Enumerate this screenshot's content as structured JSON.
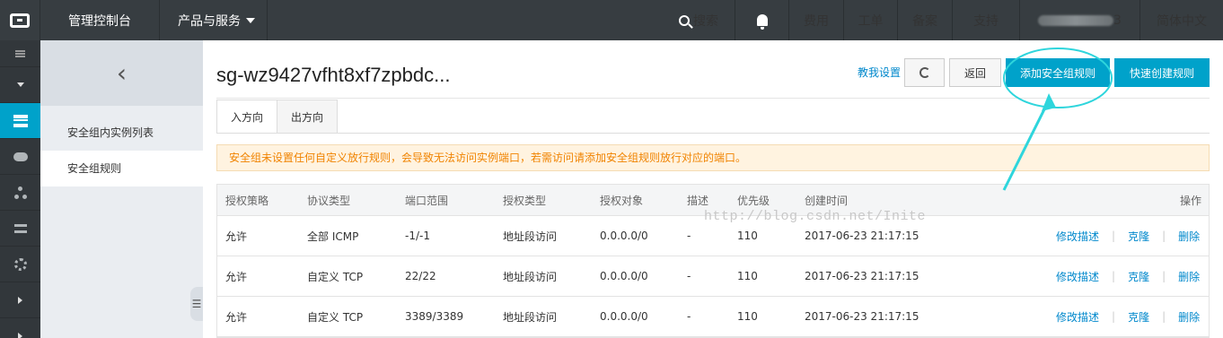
{
  "topbar": {
    "console": "管理控制台",
    "products": "产品与服务",
    "search": "搜索",
    "billing": "费用",
    "tickets": "工单",
    "filing": "备案",
    "support": "支持",
    "user_suffix": "3",
    "language": "简体中文"
  },
  "subnav": {
    "items": [
      {
        "label": "安全组内实例列表"
      },
      {
        "label": "安全组规则"
      }
    ]
  },
  "main": {
    "title": "sg-wz9427vfht8xf7zpbdc...",
    "help": "教我设置",
    "back": "返回",
    "add_rule": "添加安全组规则",
    "quick_create": "快速创建规则",
    "tabs": [
      {
        "label": "入方向"
      },
      {
        "label": "出方向"
      }
    ],
    "notice": "安全组未设置任何自定义放行规则，会导致无法访问实例端口，若需访问请添加安全组规则放行对应的端口。",
    "watermark": "http://blog.csdn.net/Inite"
  },
  "table": {
    "headers": [
      "授权策略",
      "协议类型",
      "端口范围",
      "授权类型",
      "授权对象",
      "描述",
      "优先级",
      "创建时间",
      "操作"
    ],
    "rows": [
      {
        "policy": "允许",
        "protocol": "全部 ICMP",
        "port": "-1/-1",
        "auth_type": "地址段访问",
        "object": "0.0.0.0/0",
        "desc": "-",
        "priority": "110",
        "created": "2017-06-23 21:17:15"
      },
      {
        "policy": "允许",
        "protocol": "自定义 TCP",
        "port": "22/22",
        "auth_type": "地址段访问",
        "object": "0.0.0.0/0",
        "desc": "-",
        "priority": "110",
        "created": "2017-06-23 21:17:15"
      },
      {
        "policy": "允许",
        "protocol": "自定义 TCP",
        "port": "3389/3389",
        "auth_type": "地址段访问",
        "object": "0.0.0.0/0",
        "desc": "-",
        "priority": "110",
        "created": "2017-06-23 21:17:15"
      }
    ],
    "ops": {
      "edit": "修改描述",
      "clone": "克隆",
      "delete": "删除"
    }
  },
  "colors": {
    "topbar": "#373d41",
    "accent": "#00a2ca",
    "link": "#0088cc",
    "notice_text": "#f08300",
    "annotation": "#2ed5dc"
  }
}
